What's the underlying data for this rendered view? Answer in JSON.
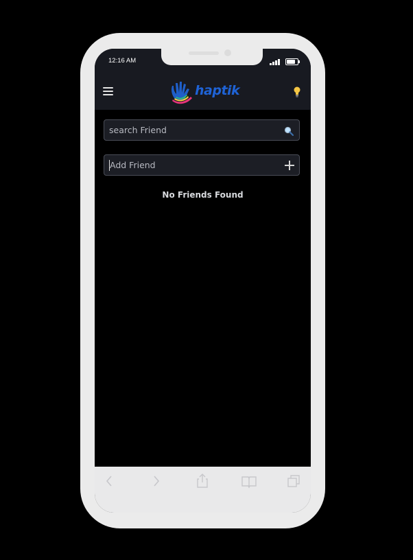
{
  "status_bar": {
    "time": "12:16 AM"
  },
  "header": {
    "logo_text": "haptik",
    "menu_icon": "hamburger-menu-icon",
    "theme_icon": "lightbulb-icon"
  },
  "search": {
    "placeholder": "search Friend",
    "icon": "magnifier-icon"
  },
  "add_friend": {
    "placeholder": "Add Friend",
    "icon": "plus-icon"
  },
  "friends": {
    "empty_message": "No Friends Found",
    "items": []
  },
  "browser_toolbar": {
    "items": [
      "back-icon",
      "forward-icon",
      "share-icon",
      "bookmarks-icon",
      "tabs-icon"
    ]
  },
  "colors": {
    "page_background": "#000000",
    "header_background": "#181a21",
    "field_background": "#1c1e25",
    "field_border": "#4a4d57",
    "logo_blue": "#1f63d6",
    "bulb_yellow": "#f5c644",
    "toolbar_background": "#e9e9ea",
    "frame": "#ebebeb"
  }
}
